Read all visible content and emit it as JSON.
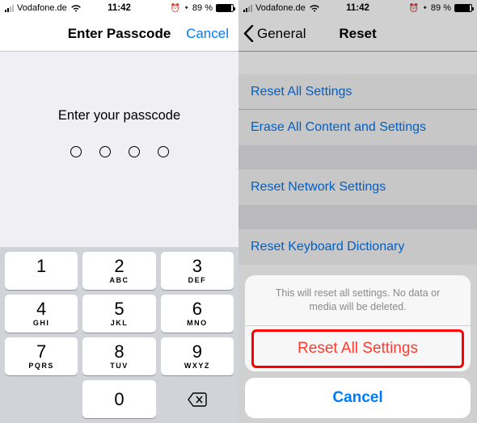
{
  "status": {
    "carrier": "Vodafone.de",
    "time": "11:42",
    "alarm": "⏰",
    "bluetooth": "✱",
    "battery_pct": "89 %"
  },
  "left": {
    "title": "Enter Passcode",
    "cancel": "Cancel",
    "prompt": "Enter your passcode",
    "keys": {
      "k1": "1",
      "k2": "2",
      "k2l": "ABC",
      "k3": "3",
      "k3l": "DEF",
      "k4": "4",
      "k4l": "GHI",
      "k5": "5",
      "k5l": "JKL",
      "k6": "6",
      "k6l": "MNO",
      "k7": "7",
      "k7l": "PQRS",
      "k8": "8",
      "k8l": "TUV",
      "k9": "9",
      "k9l": "WXYZ",
      "k0": "0"
    }
  },
  "right": {
    "back": "General",
    "title": "Reset",
    "items": {
      "reset_all": "Reset All Settings",
      "erase_all": "Erase All Content and Settings",
      "reset_network": "Reset Network Settings",
      "reset_keyboard": "Reset Keyboard Dictionary"
    },
    "sheet": {
      "message": "This will reset all settings. No data or media will be deleted.",
      "action": "Reset All Settings",
      "cancel": "Cancel"
    }
  }
}
